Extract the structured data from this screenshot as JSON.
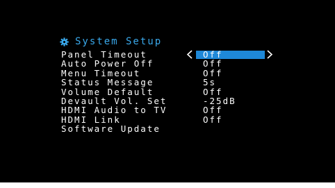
{
  "header": {
    "title": "System Setup",
    "icon": "gear-icon"
  },
  "colors": {
    "background": "#000000",
    "title": "#3aa9ec",
    "text": "#ffffff",
    "highlight": "#1e88d8"
  },
  "menu": {
    "selected_index": 0,
    "items": [
      {
        "label": "Panel Timeout",
        "value": "Off"
      },
      {
        "label": "Auto Power Off",
        "value": "Off"
      },
      {
        "label": "Menu Timeout",
        "value": "Off"
      },
      {
        "label": "Status Message",
        "value": "5s"
      },
      {
        "label": "Volume Default",
        "value": "Off"
      },
      {
        "label": "Devault Vol. Set",
        "value": "-25dB"
      },
      {
        "label": "HDMI Audio to TV",
        "value": "Off"
      },
      {
        "label": "HDMI Link",
        "value": "Off"
      },
      {
        "label": "Software Update",
        "value": ""
      }
    ]
  }
}
